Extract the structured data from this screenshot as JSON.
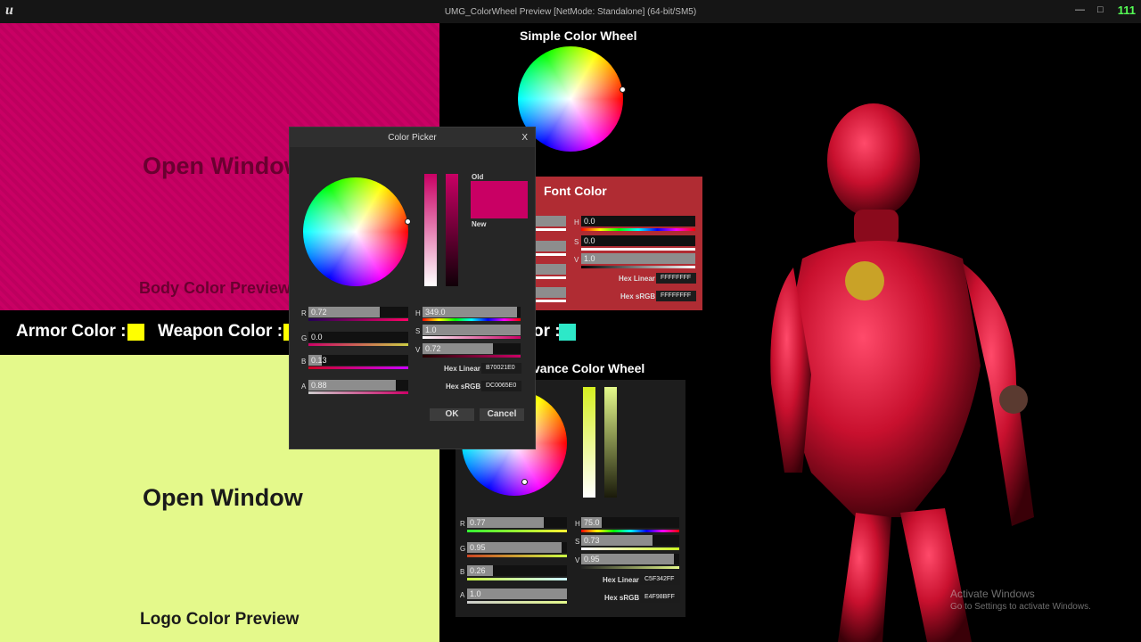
{
  "window": {
    "title": "UMG_ColorWheel Preview [NetMode: Standalone]  (64-bit/SM5)",
    "logo": "u",
    "fps": "111",
    "minimize_icon": "—",
    "restore_icon": "□",
    "close_icon": "×"
  },
  "body_preview": {
    "open_label": "Open Window",
    "label": "Body Color Preview",
    "color": "#c90064"
  },
  "color_bar": {
    "armor_label": "Armor Color :",
    "armor_color": "#ffff00",
    "weapon_label": "Weapon Color :",
    "weapon_color": "#ffff00",
    "other_label_tail": "or :",
    "other_color": "#2de8c8"
  },
  "logo_preview": {
    "open_label": "Open Window",
    "label": "Logo Color Preview",
    "color": "#e4f98b"
  },
  "simple_wheel": {
    "title": "Simple Color Wheel"
  },
  "font_panel": {
    "title": "Font Color",
    "h_label": "H",
    "h_value": "0.0",
    "s_label": "S",
    "s_value": "0.0",
    "v_label": "V",
    "v_value": "1.0",
    "hex_linear_label": "Hex Linear",
    "hex_linear": "FFFFFFFF",
    "hex_srgb_label": "Hex sRGB",
    "hex_srgb": "FFFFFFFF"
  },
  "advanced_panel": {
    "title_tail": "vance Color Wheel",
    "r_label": "R",
    "r_value": "0.77",
    "g_label": "G",
    "g_value": "0.95",
    "b_label": "B",
    "b_value": "0.26",
    "a_label": "A",
    "a_value": "1.0",
    "h_label": "H",
    "h_value": "75.0",
    "s_label": "S",
    "s_value": "0.73",
    "v_label": "V",
    "v_value": "0.95",
    "hex_linear_label": "Hex Linear",
    "hex_linear": "C5F342FF",
    "hex_srgb_label": "Hex sRGB",
    "hex_srgb": "E4F98BFF"
  },
  "picker": {
    "title": "Color Picker",
    "close": "X",
    "old_label": "Old",
    "new_label": "New",
    "r_label": "R",
    "r_value": "0.72",
    "g_label": "G",
    "g_value": "0.0",
    "b_label": "B",
    "b_value": "0.13",
    "a_label": "A",
    "a_value": "0.88",
    "h_label": "H",
    "h_value": "349.0",
    "s_label": "S",
    "s_value": "1.0",
    "v_label": "V",
    "v_value": "0.72",
    "hex_linear_label": "Hex Linear",
    "hex_linear": "B70021E0",
    "hex_srgb_label": "Hex sRGB",
    "hex_srgb": "DC0065E0",
    "ok": "OK",
    "cancel": "Cancel",
    "swatch_color": "#c90064"
  },
  "watermark": {
    "line1": "Activate Windows",
    "line2": "Go to Settings to activate Windows."
  }
}
